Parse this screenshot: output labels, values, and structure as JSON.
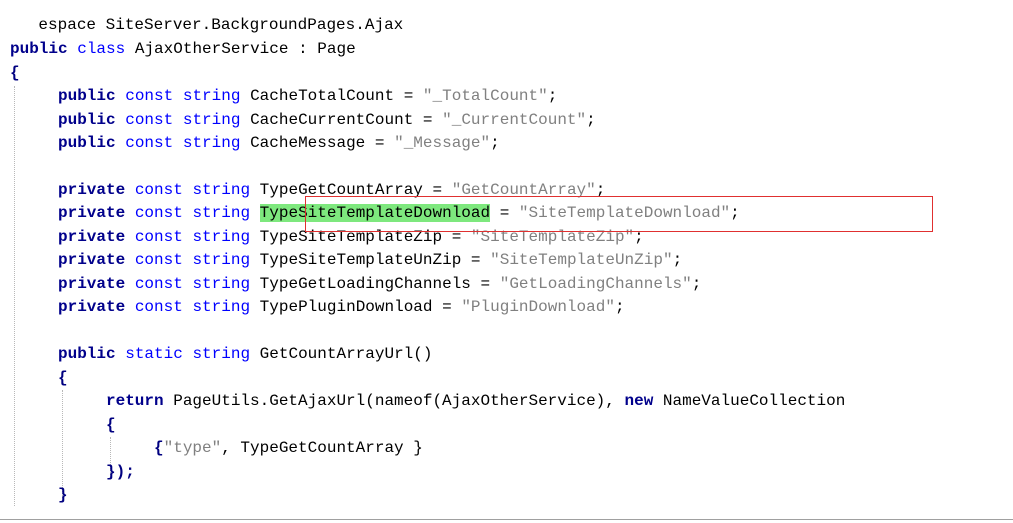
{
  "editor": {
    "namespace_line": "espace SiteServer.BackgroundPages.Ajax",
    "class_decl": {
      "kw1": "public",
      "kw2": "class",
      "name": "AjaxOtherService",
      "sep": " : ",
      "base": "Page"
    },
    "open_brace": "{",
    "const_public": [
      {
        "mod": "public",
        "const": "const",
        "type": "string",
        "name": "CacheTotalCount",
        "eq": " = ",
        "value": "\"_TotalCount\"",
        "end": ";"
      },
      {
        "mod": "public",
        "const": "const",
        "type": "string",
        "name": "CacheCurrentCount",
        "eq": " = ",
        "value": "\"_CurrentCount\"",
        "end": ";"
      },
      {
        "mod": "public",
        "const": "const",
        "type": "string",
        "name": "CacheMessage",
        "eq": " = ",
        "value": "\"_Message\"",
        "end": ";"
      }
    ],
    "const_private": [
      {
        "mod": "private",
        "const": "const",
        "type": "string",
        "name": "TypeGetCountArray",
        "eq": " = ",
        "value": "\"GetCountArray\"",
        "end": ";"
      },
      {
        "mod": "private",
        "const": "const",
        "type": "string",
        "name": "TypeSiteTemplateDownload",
        "eq": " = ",
        "value": "\"SiteTemplateDownload\"",
        "end": ";"
      },
      {
        "mod": "private",
        "const": "const",
        "type": "string",
        "name": "TypeSiteTemplateZip",
        "eq": " = ",
        "value": "\"SiteTemplateZip\"",
        "end": ";"
      },
      {
        "mod": "private",
        "const": "const",
        "type": "string",
        "name": "TypeSiteTemplateUnZip",
        "eq": " = ",
        "value": "\"SiteTemplateUnZip\"",
        "end": ";"
      },
      {
        "mod": "private",
        "const": "const",
        "type": "string",
        "name": "TypeGetLoadingChannels",
        "eq": " = ",
        "value": "\"GetLoadingChannels\"",
        "end": ";"
      },
      {
        "mod": "private",
        "const": "const",
        "type": "string",
        "name": "TypePluginDownload",
        "eq": " = ",
        "value": "\"PluginDownload\"",
        "end": ";"
      }
    ],
    "method_decl": {
      "kw1": "public",
      "kw2": "static",
      "type": "string",
      "name": "GetCountArrayUrl()"
    },
    "method_open": "{",
    "return_line": {
      "kw": "return",
      "call": " PageUtils.GetAjaxUrl(nameof(AjaxOtherService), ",
      "kw_new": "new",
      "ctor": " NameValueCollection"
    },
    "init_open": "{",
    "init_entry": {
      "open": "{",
      "key": "\"type\"",
      "rest": ", TypeGetCountArray }"
    },
    "init_close": "});",
    "method_close": "}"
  },
  "highlight": {
    "selected_identifier": "TypeSiteTemplateDownload",
    "highlight_color": "#7ee87e",
    "annotation_box_color": "#e03030"
  },
  "colors": {
    "keyword": "#0000ff",
    "modifier": "#00008b",
    "string": "#808080",
    "text": "#000000"
  }
}
